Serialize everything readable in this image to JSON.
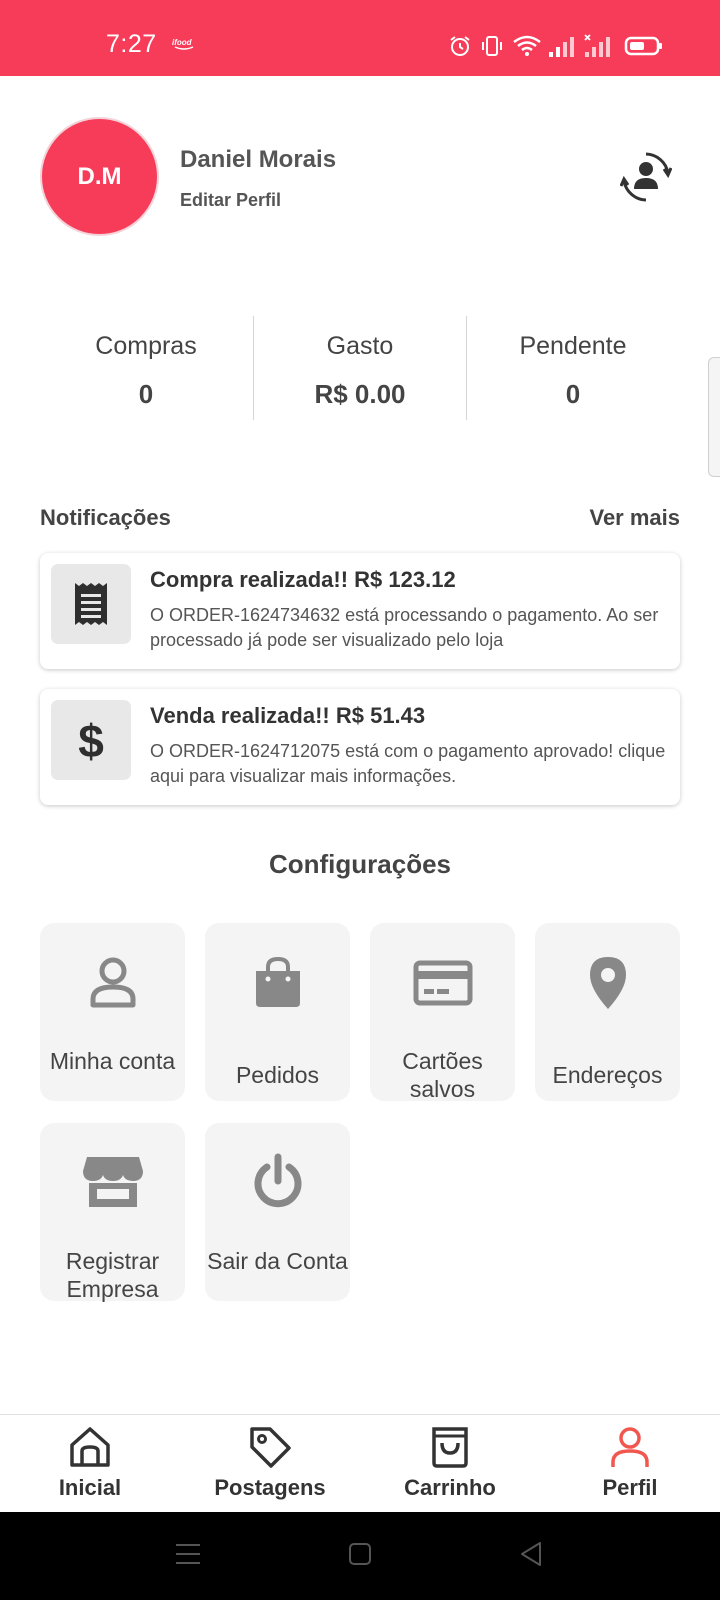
{
  "status_bar": {
    "time": "7:27",
    "background": "#f73c5a"
  },
  "profile": {
    "initials": "D.M",
    "name": "Daniel Morais",
    "edit_label": "Editar Perfil",
    "avatar_color": "#f73c5a"
  },
  "stats": [
    {
      "label": "Compras",
      "value": "0"
    },
    {
      "label": "Gasto",
      "value": "R$ 0.00"
    },
    {
      "label": "Pendente",
      "value": "0"
    }
  ],
  "notifications": {
    "title": "Notificações",
    "see_more": "Ver mais",
    "items": [
      {
        "icon": "receipt-icon",
        "title": "Compra realizada!! R$ 123.12",
        "message": "O ORDER-1624734632 está processando o pagamento. Ao ser processado já pode ser visualizado pelo loja"
      },
      {
        "icon": "dollar-icon",
        "title": "Venda realizada!! R$ 51.43",
        "message": "O ORDER-1624712075 está com o pagamento aprovado! clique aqui para visualizar mais informações."
      }
    ]
  },
  "settings": {
    "title": "Configurações",
    "items": [
      {
        "icon": "user-icon",
        "label": "Minha conta"
      },
      {
        "icon": "shopping-bag-icon",
        "label": "Pedidos"
      },
      {
        "icon": "credit-card-icon",
        "label": "Cartões salvos"
      },
      {
        "icon": "location-pin-icon",
        "label": "Endereços"
      },
      {
        "icon": "store-icon",
        "label": "Registrar Empresa"
      },
      {
        "icon": "power-icon",
        "label": "Sair da Conta"
      }
    ]
  },
  "bottom_nav": {
    "active_color": "#f0584f",
    "items": [
      {
        "icon": "home-icon",
        "label": "Inicial"
      },
      {
        "icon": "tag-icon",
        "label": "Postagens"
      },
      {
        "icon": "cart-bag-icon",
        "label": "Carrinho"
      },
      {
        "icon": "person-icon",
        "label": "Perfil",
        "active": true
      }
    ]
  }
}
